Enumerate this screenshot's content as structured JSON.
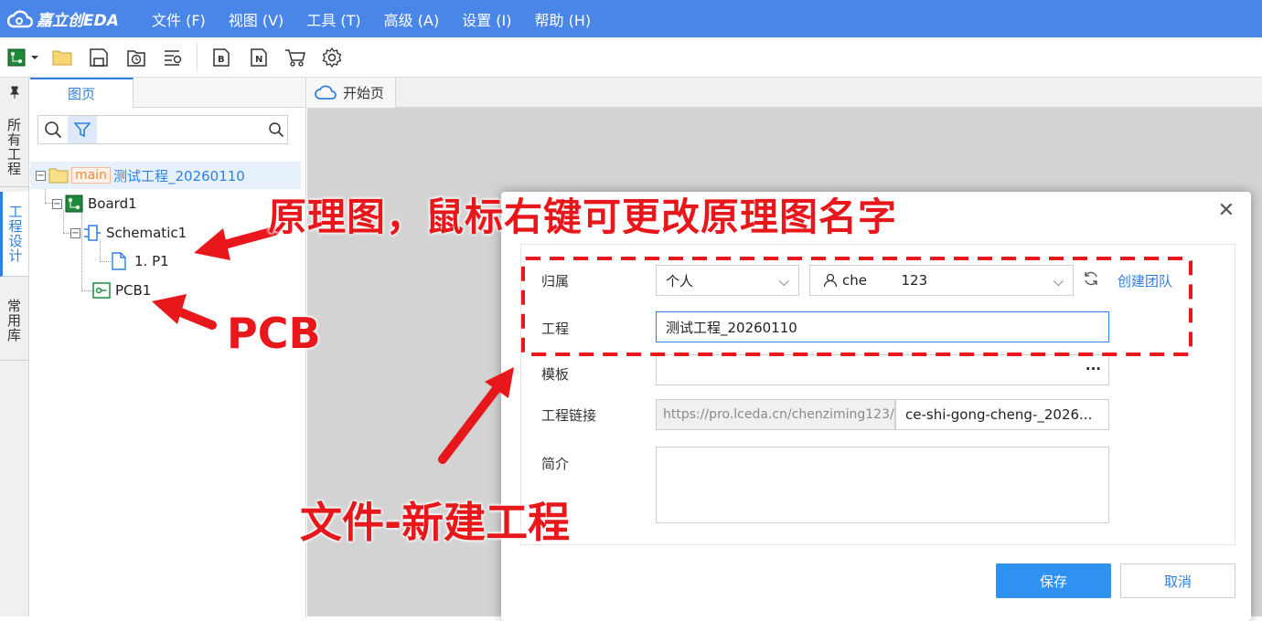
{
  "app": {
    "logo_text": "嘉立创EDA"
  },
  "menu": [
    "文件 (F)",
    "视图 (V)",
    "工具 (T)",
    "高级 (A)",
    "设置 (I)",
    "帮助 (H)"
  ],
  "toolbar": {
    "icons": [
      "new-board-icon",
      "open-folder-icon",
      "save-icon",
      "history-icon",
      "search-list-icon",
      "bom-icon",
      "netlist-icon",
      "order-cart-icon",
      "settings-gear-icon"
    ]
  },
  "left_vtabs": [
    "所有工程",
    "工程设计",
    "常用库"
  ],
  "panel": {
    "tab_label": "图页",
    "search_placeholder": "",
    "tree": {
      "project_tag": "main",
      "project_name": "测试工程_20260110",
      "board": "Board1",
      "schematic": "Schematic1",
      "page": "1. P1",
      "pcb": "PCB1"
    }
  },
  "editor_tabs": [
    "开始页"
  ],
  "dialog": {
    "fields": {
      "owner_label": "归属",
      "owner_type": "个人",
      "owner_user": "che     123",
      "project_label": "工程",
      "project_value": "测试工程_20260110",
      "template_label": "模板",
      "template_more": "···",
      "link_label": "工程链接",
      "link_prefix": "https://pro.lceda.cn/chenziming123/",
      "link_slug": "ce-shi-gong-cheng-_2026...",
      "intro_label": "简介",
      "create_team_link": "创建团队"
    },
    "save_label": "保存",
    "cancel_label": "取消"
  },
  "annotations": {
    "schematic_note": "原理图，鼠标右键可更改原理图名字",
    "pcb_note": "PCB",
    "new_project_note": "文件-新建工程",
    "color": "#e8171b"
  }
}
